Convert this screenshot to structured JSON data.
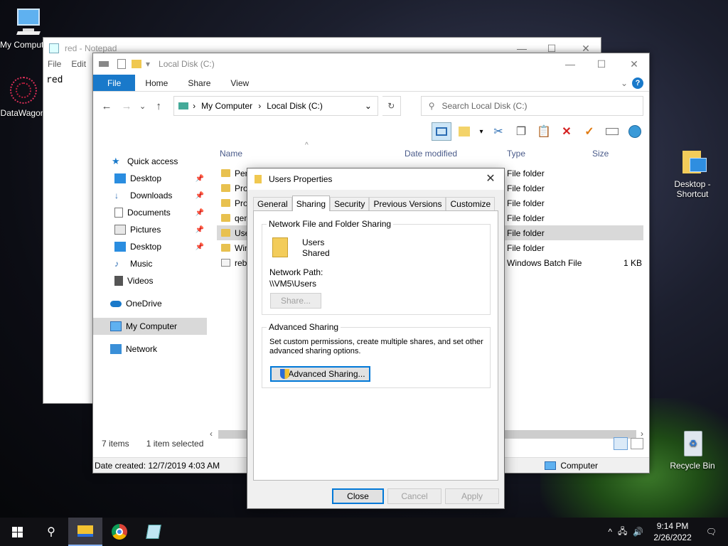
{
  "desktop": {
    "icons": [
      {
        "label": "My Computer"
      },
      {
        "label": "DataWagon"
      },
      {
        "label": "Desktop - Shortcut"
      },
      {
        "label": "Recycle Bin"
      }
    ]
  },
  "notepad": {
    "title": "red - Notepad",
    "menu": [
      "File",
      "Edit"
    ],
    "content": "red"
  },
  "explorer": {
    "title": "Local Disk (C:)",
    "ribbon_tabs": [
      "File",
      "Home",
      "Share",
      "View"
    ],
    "breadcrumb": [
      "My Computer",
      "Local Disk (C:)"
    ],
    "search_placeholder": "Search Local Disk (C:)",
    "nav": {
      "quick_access": "Quick access",
      "items": [
        {
          "label": "Desktop",
          "pinned": true
        },
        {
          "label": "Downloads",
          "pinned": true
        },
        {
          "label": "Documents",
          "pinned": true
        },
        {
          "label": "Pictures",
          "pinned": true
        },
        {
          "label": "Desktop",
          "pinned": true
        },
        {
          "label": "Music",
          "pinned": false
        },
        {
          "label": "Videos",
          "pinned": false
        }
      ],
      "onedrive": "OneDrive",
      "my_computer": "My Computer",
      "network": "Network"
    },
    "columns": {
      "name": "Name",
      "date": "Date modified",
      "type": "Type",
      "size": "Size"
    },
    "files": [
      {
        "name": "Perf",
        "type": "File folder",
        "size": ""
      },
      {
        "name": "Pro",
        "type": "File folder",
        "size": ""
      },
      {
        "name": "Pro",
        "type": "File folder",
        "size": ""
      },
      {
        "name": "qen",
        "type": "File folder",
        "size": ""
      },
      {
        "name": "Use",
        "type": "File folder",
        "size": ""
      },
      {
        "name": "Win",
        "type": "File folder",
        "size": ""
      },
      {
        "name": "rebo",
        "type": "Windows Batch File",
        "size": "1 KB"
      }
    ],
    "status_items": "7 items",
    "status_selected": "1 item selected",
    "date_created": "Date created: 12/7/2019 4:03 AM",
    "location": "Computer"
  },
  "dialog": {
    "title": "Users Properties",
    "tabs": [
      "General",
      "Sharing",
      "Security",
      "Previous Versions",
      "Customize"
    ],
    "active_tab": "Sharing",
    "nffs_title": "Network File and Folder Sharing",
    "share_name": "Users",
    "share_state": "Shared",
    "network_path_label": "Network Path:",
    "network_path": "\\\\VM5\\Users",
    "share_button": "Share...",
    "adv_title": "Advanced Sharing",
    "adv_desc_1": "Set custom permissions, create multiple shares, and set other",
    "adv_desc_2": "advanced sharing options.",
    "adv_button": "Advanced Sharing...",
    "close": "Close",
    "cancel": "Cancel",
    "apply": "Apply"
  },
  "taskbar": {
    "time": "9:14 PM",
    "date": "2/26/2022"
  }
}
